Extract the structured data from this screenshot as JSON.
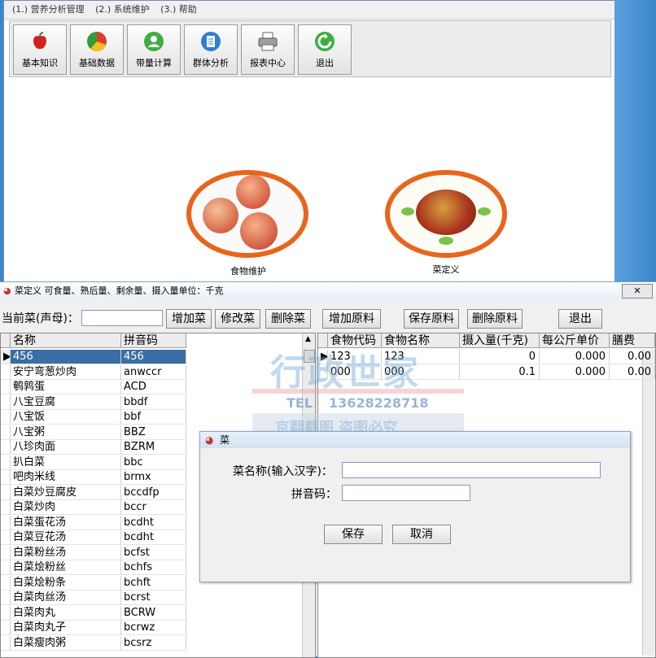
{
  "menu": [
    "(1.) 营养分析管理",
    "(2.) 系统维护",
    "(3.) 帮助"
  ],
  "toolbar": [
    {
      "label": "基本知识",
      "icon": "apple-icon"
    },
    {
      "label": "基础数据",
      "icon": "pie-chart-icon"
    },
    {
      "label": "带量计算",
      "icon": "user-icon"
    },
    {
      "label": "群体分析",
      "icon": "document-icon"
    },
    {
      "label": "报表中心",
      "icon": "printer-icon"
    },
    {
      "label": "退出",
      "icon": "exit-icon"
    }
  ],
  "tiles": [
    {
      "label": "食物维护",
      "image": "apples-plate"
    },
    {
      "label": "菜定义",
      "image": "dish-plate"
    }
  ],
  "dish_window": {
    "title": "菜定义  可食量、熟后量、剩余量、摄入量单位：千克",
    "current_dish_label": "当前菜(声母)：",
    "add_dish": "增加菜",
    "edit_dish": "修改菜",
    "delete_dish": "删除菜",
    "add_ingredient": "增加原料",
    "save_ingredient": "保存原料",
    "delete_ingredient": "删除原料",
    "exit": "退出",
    "dish_columns": [
      "名称",
      "拼音码"
    ],
    "dishes": [
      [
        "456",
        "456"
      ],
      [
        "安宁弯葱炒肉",
        "anwccr"
      ],
      [
        "鹌鹑蛋",
        "ACD"
      ],
      [
        "八宝豆腐",
        "bbdf"
      ],
      [
        "八宝饭",
        "bbf"
      ],
      [
        "八宝粥",
        "BBZ"
      ],
      [
        "八珍肉面",
        "BZRM"
      ],
      [
        "扒白菜",
        "bbc"
      ],
      [
        "吧肉米线",
        "brmx"
      ],
      [
        "白菜炒豆腐皮",
        "bccdfp"
      ],
      [
        "白菜炒肉",
        "bccr"
      ],
      [
        "白菜蛋花汤",
        "bcdht"
      ],
      [
        "白菜豆花汤",
        "bcdht"
      ],
      [
        "白菜粉丝汤",
        "bcfst"
      ],
      [
        "白菜烩粉丝",
        "bchfs"
      ],
      [
        "白菜烩粉条",
        "bchft"
      ],
      [
        "白菜肉丝汤",
        "bcrst"
      ],
      [
        "白菜肉丸",
        "BCRW"
      ],
      [
        "白菜肉丸子",
        "bcrwz"
      ],
      [
        "白菜瘦肉粥",
        "bcsrz"
      ]
    ],
    "ingredient_columns": [
      "食物代码",
      "食物名称",
      "摄入量(千克)",
      "每公斤单价",
      "膳费"
    ],
    "ingredients": [
      [
        "123",
        "123",
        "0",
        "0.000",
        "0.00"
      ],
      [
        "000",
        "000",
        "0.1",
        "0.000",
        "0.00"
      ]
    ]
  },
  "dialog": {
    "title": "菜",
    "name_label": "菜名称(输入汉字)：",
    "name_value": "",
    "pinyin_label": "拼音码：",
    "pinyin_value": "",
    "save": "保存",
    "cancel": "取消"
  },
  "watermark": {
    "brand": "行政世家",
    "tel_label": "TEL",
    "tel": "13628228718",
    "notice": "京翻截图 盗图必究"
  }
}
